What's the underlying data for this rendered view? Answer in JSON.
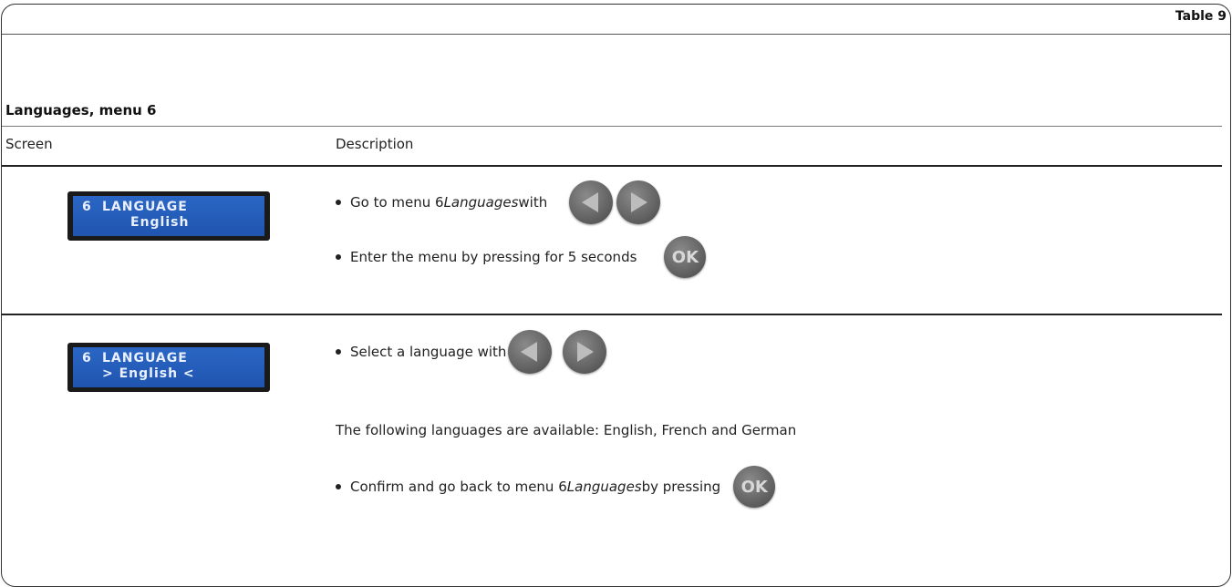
{
  "table_tag": "Table 9",
  "section_title": "Languages, menu 6",
  "columns": {
    "screen": "Screen",
    "description": "Description"
  },
  "rows": [
    {
      "lcd": {
        "number": "6",
        "line1": "LANGUAGE",
        "line2": "English"
      },
      "steps": [
        {
          "pre": "Go to menu 6 ",
          "em": "Languages",
          "post": " with"
        },
        {
          "pre": "Enter the menu by pressing for 5 seconds"
        }
      ]
    },
    {
      "lcd": {
        "number": "6",
        "line1": "LANGUAGE",
        "line2": "> English <"
      },
      "steps": [
        {
          "pre": "Select a language with"
        },
        {
          "pre": "The following languages are available: English, French and German"
        },
        {
          "pre": "Confirm and go back to menu 6 ",
          "em": "Languages",
          "post": " by pressing"
        }
      ]
    }
  ],
  "buttons": {
    "ok_label": "OK",
    "left_icon": "arrow-left-icon",
    "right_icon": "arrow-right-icon"
  },
  "colors": {
    "lcd_blue": "#2b66c4",
    "button_gray": "#5c5c5c"
  }
}
